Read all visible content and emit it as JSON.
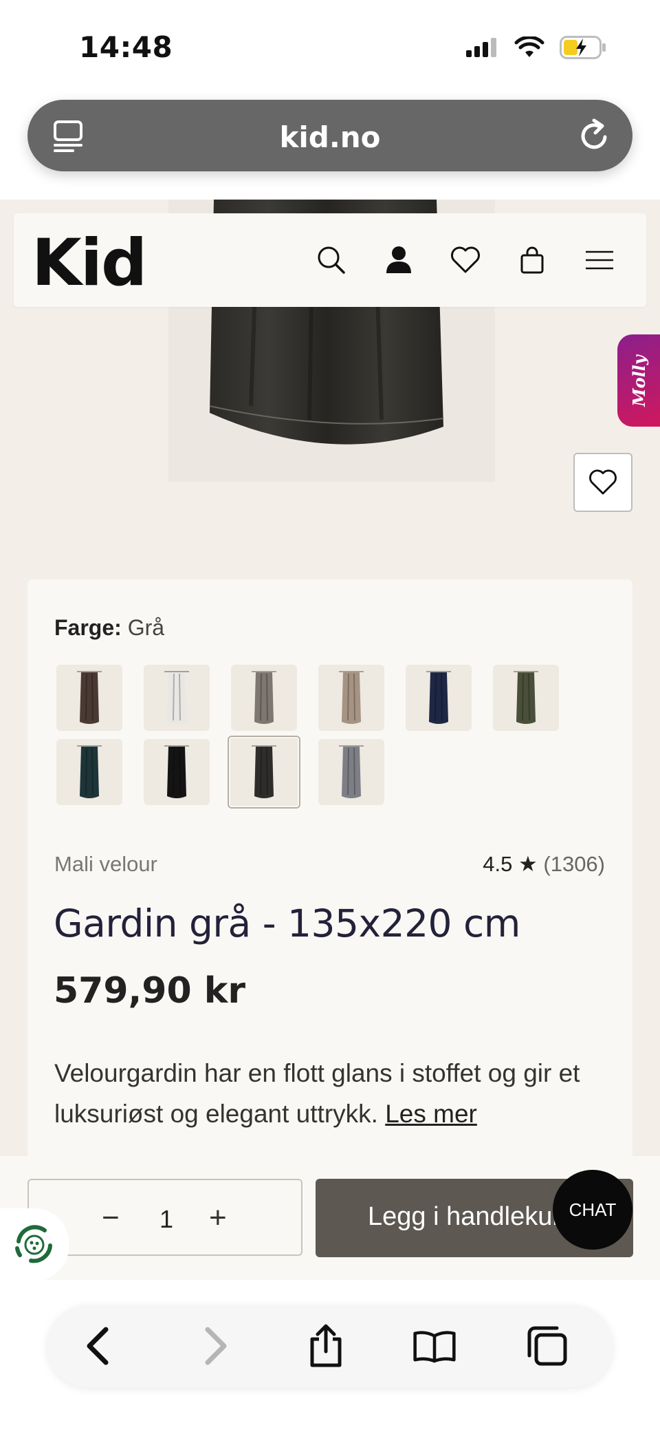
{
  "status_bar": {
    "time": "14:48"
  },
  "browser": {
    "url": "kid.no"
  },
  "header": {
    "logo": "Kid"
  },
  "side_tab": {
    "label": "Molly"
  },
  "product": {
    "color_label": "Farge:",
    "color_value": "Grå",
    "swatches": [
      {
        "color": "#4a3a33"
      },
      {
        "color": "#e9e7e4"
      },
      {
        "color": "#7e766f"
      },
      {
        "color": "#a69383"
      },
      {
        "color": "#1e2744"
      },
      {
        "color": "#4a4f3a"
      },
      {
        "color": "#1d3538"
      },
      {
        "color": "#141414"
      },
      {
        "color": "#2e2d2b",
        "selected": true
      },
      {
        "color": "#7e7e86"
      }
    ],
    "collection": "Mali velour",
    "rating": "4.5 ★",
    "rating_count": "(1306)",
    "title": "Gardin grå - 135x220 cm",
    "price": "579,90 kr",
    "description": "Velourgardin har en flott glans i stoffet og gir et luksuriøst og elegant uttrykk.",
    "read_more": "Les mer"
  },
  "cart_bar": {
    "minus": "−",
    "quantity": "1",
    "plus": "+",
    "add_to_cart": "Legg i handlekurv",
    "chat": "CHAT"
  }
}
